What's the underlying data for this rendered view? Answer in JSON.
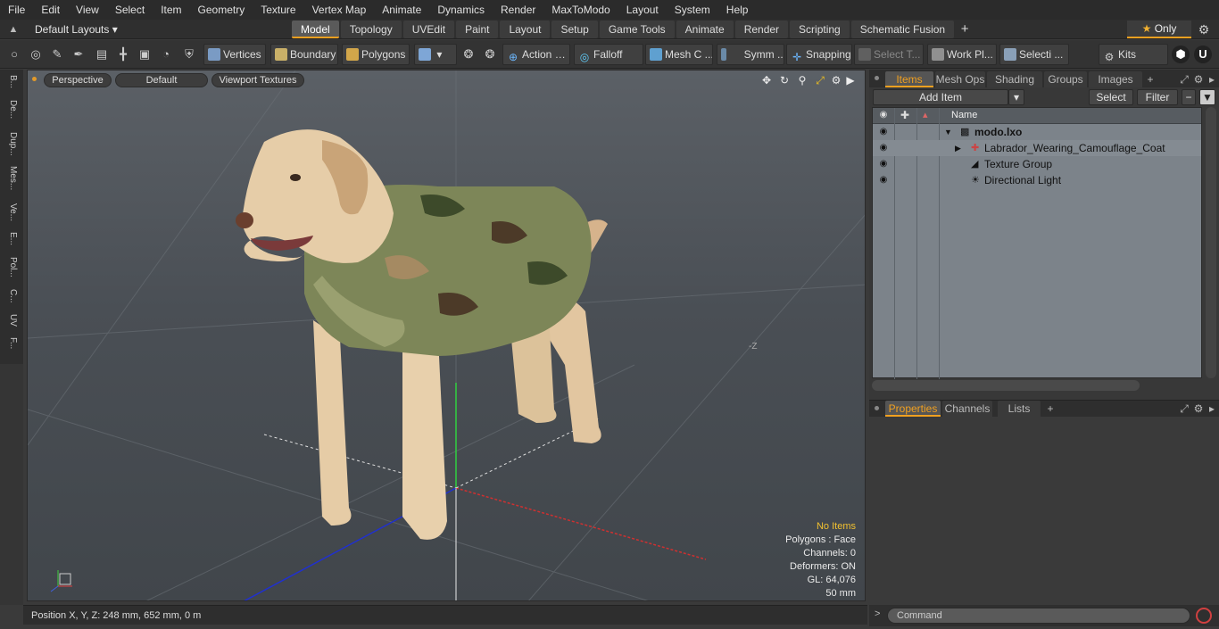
{
  "menu": [
    "File",
    "Edit",
    "View",
    "Select",
    "Item",
    "Geometry",
    "Texture",
    "Vertex Map",
    "Animate",
    "Dynamics",
    "Render",
    "MaxToModo",
    "Layout",
    "System",
    "Help"
  ],
  "layout_select": "Default Layouts",
  "tabs": [
    "Model",
    "Topology",
    "UVEdit",
    "Paint",
    "Layout",
    "Setup",
    "Game Tools",
    "Animate",
    "Render",
    "Scripting",
    "Schematic Fusion"
  ],
  "active_tab": "Model",
  "only_label": "Only",
  "toolbar": {
    "vertices": "Vertices",
    "boundary": "Boundary",
    "polygons": "Polygons",
    "action": "Action",
    "falloff": "Falloff",
    "mesh_c": "Mesh C ...",
    "symm": "Symm ...",
    "snapping": "Snapping",
    "select_t": "Select T...",
    "work_pl": "Work Pl...",
    "selecti": "Selecti ...",
    "kits": "Kits"
  },
  "left_strip": [
    "B...",
    "De...",
    "Dup...",
    "Mes...",
    "Ve...",
    "E...",
    "Pol...",
    "C...",
    "UV",
    "F..."
  ],
  "viewport": {
    "perspective": "Perspective",
    "default": "Default",
    "textures": "Viewport Textures",
    "z_label": "-Z",
    "stats": {
      "no_items": "No Items",
      "polygons": "Polygons : Face",
      "channels": "Channels: 0",
      "deformers": "Deformers: ON",
      "gl": "GL: 64,076",
      "mm": "50 mm"
    }
  },
  "status": "Position X, Y, Z:  248 mm, 652 mm, 0 m",
  "items_panel": {
    "tabs": [
      "Items",
      "Mesh Ops",
      "Shading",
      "Groups",
      "Images"
    ],
    "add_item": "Add Item",
    "select": "Select",
    "filter": "Filter",
    "name_header": "Name",
    "rows": [
      {
        "name": "modo.lxo"
      },
      {
        "name": "Labrador_Wearing_Camouflage_Coat"
      },
      {
        "name": "Texture Group"
      },
      {
        "name": "Directional Light"
      }
    ]
  },
  "properties_panel": {
    "tabs": [
      "Properties",
      "Channels",
      "Lists"
    ]
  },
  "command": {
    "placeholder": "Command"
  }
}
